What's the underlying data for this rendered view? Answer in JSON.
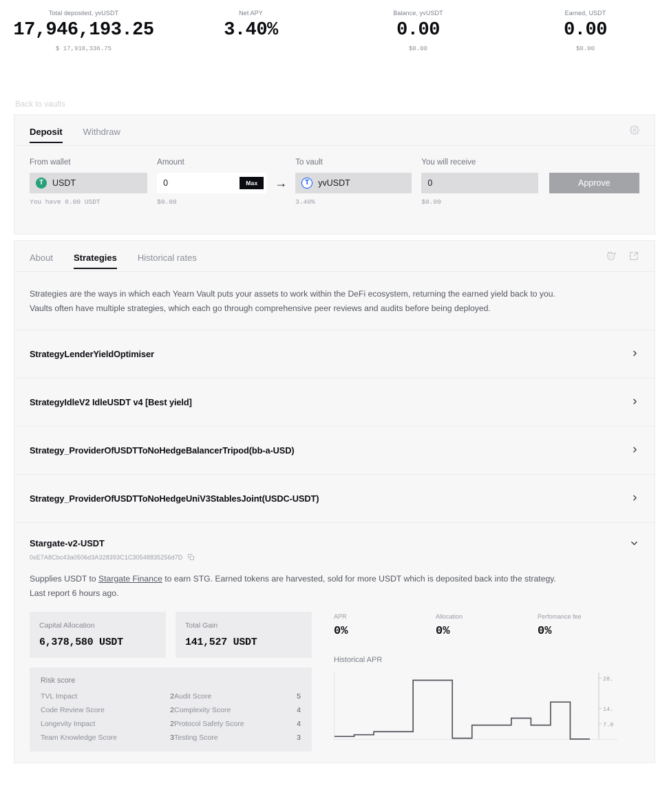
{
  "header": {
    "stats": [
      {
        "label": "Total deposited, yvUSDT",
        "value": "17,946,193.25",
        "sub": "$ 17,910,336.75"
      },
      {
        "label": "Net APY",
        "value": "3.40%",
        "sub": ""
      },
      {
        "label": "Balance, yvUSDT",
        "value": "0.00",
        "sub": "$0.00"
      },
      {
        "label": "Earned, USDT",
        "value": "0.00",
        "sub": "$0.00"
      }
    ]
  },
  "back_link": "Back to vaults",
  "deposit_card": {
    "tabs": [
      {
        "label": "Deposit",
        "active": true
      },
      {
        "label": "Withdraw",
        "active": false
      }
    ],
    "settings_icon": "gear-icon",
    "from_wallet": {
      "label": "From wallet",
      "token": "USDT",
      "token_glyph": "T",
      "hint": "You have 0.00 USDT"
    },
    "amount": {
      "label": "Amount",
      "value": "0",
      "placeholder": "0",
      "max_label": "Max",
      "hint": "$0.00"
    },
    "arrow": "→",
    "to_vault": {
      "label": "To vault",
      "token": "yvUSDT",
      "token_glyph": "T",
      "hint": "3.40%"
    },
    "you_will_receive": {
      "label": "You will receive",
      "value": "0",
      "hint": "$0.00"
    },
    "action_button": "Approve"
  },
  "details_card": {
    "tabs": [
      {
        "label": "About",
        "active": false
      },
      {
        "label": "Strategies",
        "active": true
      },
      {
        "label": "Historical rates",
        "active": false
      }
    ],
    "actions": [
      {
        "icon": "fox-wallet-add-icon"
      },
      {
        "icon": "external-link-icon"
      }
    ],
    "intro_line1": "Strategies are the ways in which each Yearn Vault puts your assets to work within the DeFi ecosystem, returning the earned yield back to you.",
    "intro_line2": "Vaults often have multiple strategies, which each go through comprehensive peer reviews and audits before being deployed.",
    "strategies": [
      {
        "name": "StrategyLenderYieldOptimiser",
        "expanded": false
      },
      {
        "name": "StrategyIdleV2 IdleUSDT v4 [Best yield]",
        "expanded": false
      },
      {
        "name": "Strategy_ProviderOfUSDTToNoHedgeBalancerTripod(bb-a-USD)",
        "expanded": false
      },
      {
        "name": "Strategy_ProviderOfUSDTToNoHedgeUniV3StablesJoint(USDC-USDT)",
        "expanded": false
      }
    ],
    "expanded_strategy": {
      "name": "Stargate-v2-USDT",
      "address": "0xE7A8Cbc43a0506d3A328393C1C30548835256d7D",
      "copy_icon": "copy-icon",
      "description_before_link": "Supplies USDT to ",
      "description_link": "Stargate Finance",
      "description_after_link": " to earn STG. Earned tokens are harvested, sold for more USDT which is deposited back into the strategy.",
      "last_report": "Last report 6 hours ago.",
      "kpis": [
        {
          "label": "Capital Allocation",
          "value": "6,378,580 USDT"
        },
        {
          "label": "Total Gain",
          "value": "141,527 USDT"
        }
      ],
      "metrics": [
        {
          "label": "APR",
          "value": "0%"
        },
        {
          "label": "Allocation",
          "value": "0%"
        },
        {
          "label": "Perfomance fee",
          "value": "0%"
        }
      ],
      "risk": {
        "title": "Risk score",
        "rows": [
          {
            "k1": "TVL Impact",
            "v1": "2",
            "k2": "Audit Score",
            "v2": "5"
          },
          {
            "k1": "Code Review Score",
            "v1": "2",
            "k2": "Complexity Score",
            "v2": "4"
          },
          {
            "k1": "Longevity Impact",
            "v1": "2",
            "k2": "Protocol Safety Score",
            "v2": "4"
          },
          {
            "k1": "Team Knowledge Score",
            "v1": "3",
            "k2": "Testing Score",
            "v2": "3"
          }
        ]
      },
      "chart_title": "Historical APR"
    }
  },
  "chart_data": {
    "type": "line",
    "title": "Historical APR",
    "xlabel": "",
    "ylabel": "",
    "ylim": [
      0,
      30
    ],
    "grid": false,
    "legend": null,
    "step": "post",
    "ytick_labels": [
      "28.",
      "14.",
      "7.0"
    ],
    "ytick_values": [
      28,
      14,
      7
    ],
    "x": [
      0,
      1,
      2,
      3,
      4,
      5,
      6,
      7,
      8,
      9,
      10,
      11,
      12
    ],
    "values": [
      1.2,
      2.0,
      3.4,
      3.4,
      27.0,
      27.0,
      0.4,
      6.4,
      6.4,
      9.6,
      6.4,
      17.0,
      0.0
    ]
  },
  "colors": {
    "page_bg": "#ffffff",
    "card_bg": "#f7f7f8",
    "border": "#ececee",
    "text": "#13141a",
    "muted": "#8b8f98",
    "accent_dark": "#0b0c10",
    "usdt_green": "#26a17b",
    "yearn_blue": "#0657f9",
    "approve_grey": "#a3a4a8",
    "chart_line": "#54565c"
  }
}
